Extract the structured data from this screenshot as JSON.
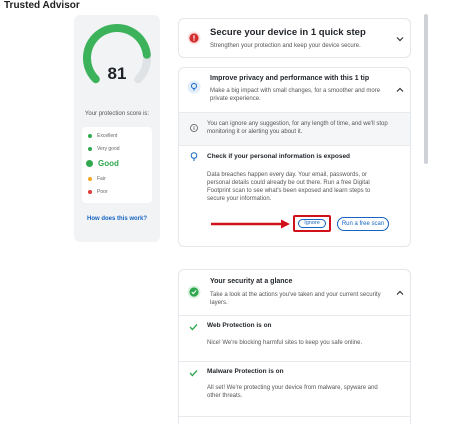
{
  "app": {
    "title": "Trusted Advisor"
  },
  "score": {
    "value": "81",
    "caption": "Your protection score is:",
    "fraction": 0.81,
    "legend": [
      {
        "label": "Excellent",
        "color": "#2fa84f"
      },
      {
        "label": "Very good",
        "color": "#2fa84f"
      },
      {
        "label": "Good",
        "color": "#2fa84f"
      },
      {
        "label": "Fair",
        "color": "#f5a623"
      },
      {
        "label": "Poor",
        "color": "#e53935"
      }
    ],
    "how_link": "How does this work?"
  },
  "secure_card": {
    "title": "Secure your device in 1 quick step",
    "subtitle": "Strengthen your protection and keep your device secure."
  },
  "privacy_card": {
    "title": "Improve privacy and performance with this 1 tip",
    "subtitle": "Make a big impact with small changes, for a smoother and more private experience.",
    "info_text": "You can ignore any suggestion, for any length of time, and we'll stop monitoring it or alerting you about it.",
    "tip": {
      "title": "Check if your personal information is exposed",
      "body": "Data breaches happen every day. Your email, passwords, or personal details could already be out there. Run a free Digital Footprint scan to see what's been exposed and learn steps to secure your information.",
      "ignore_label": "Ignore",
      "scan_label": "Run a free scan"
    }
  },
  "glance_card": {
    "title": "Your security at a glance",
    "subtitle": "Take a look at the actions you've taken and your current security layers.",
    "items": [
      {
        "title": "Web Protection is on",
        "desc": "Nice! We're blocking harmful sites to keep you safe online."
      },
      {
        "title": "Malware Protection is on",
        "desc": "All set! We're protecting your device from malware, spyware and other threats."
      }
    ]
  },
  "colors": {
    "accent": "#1565c0",
    "success": "#2fa84f",
    "danger": "#d32f2f",
    "annotation": "#d0101a"
  }
}
